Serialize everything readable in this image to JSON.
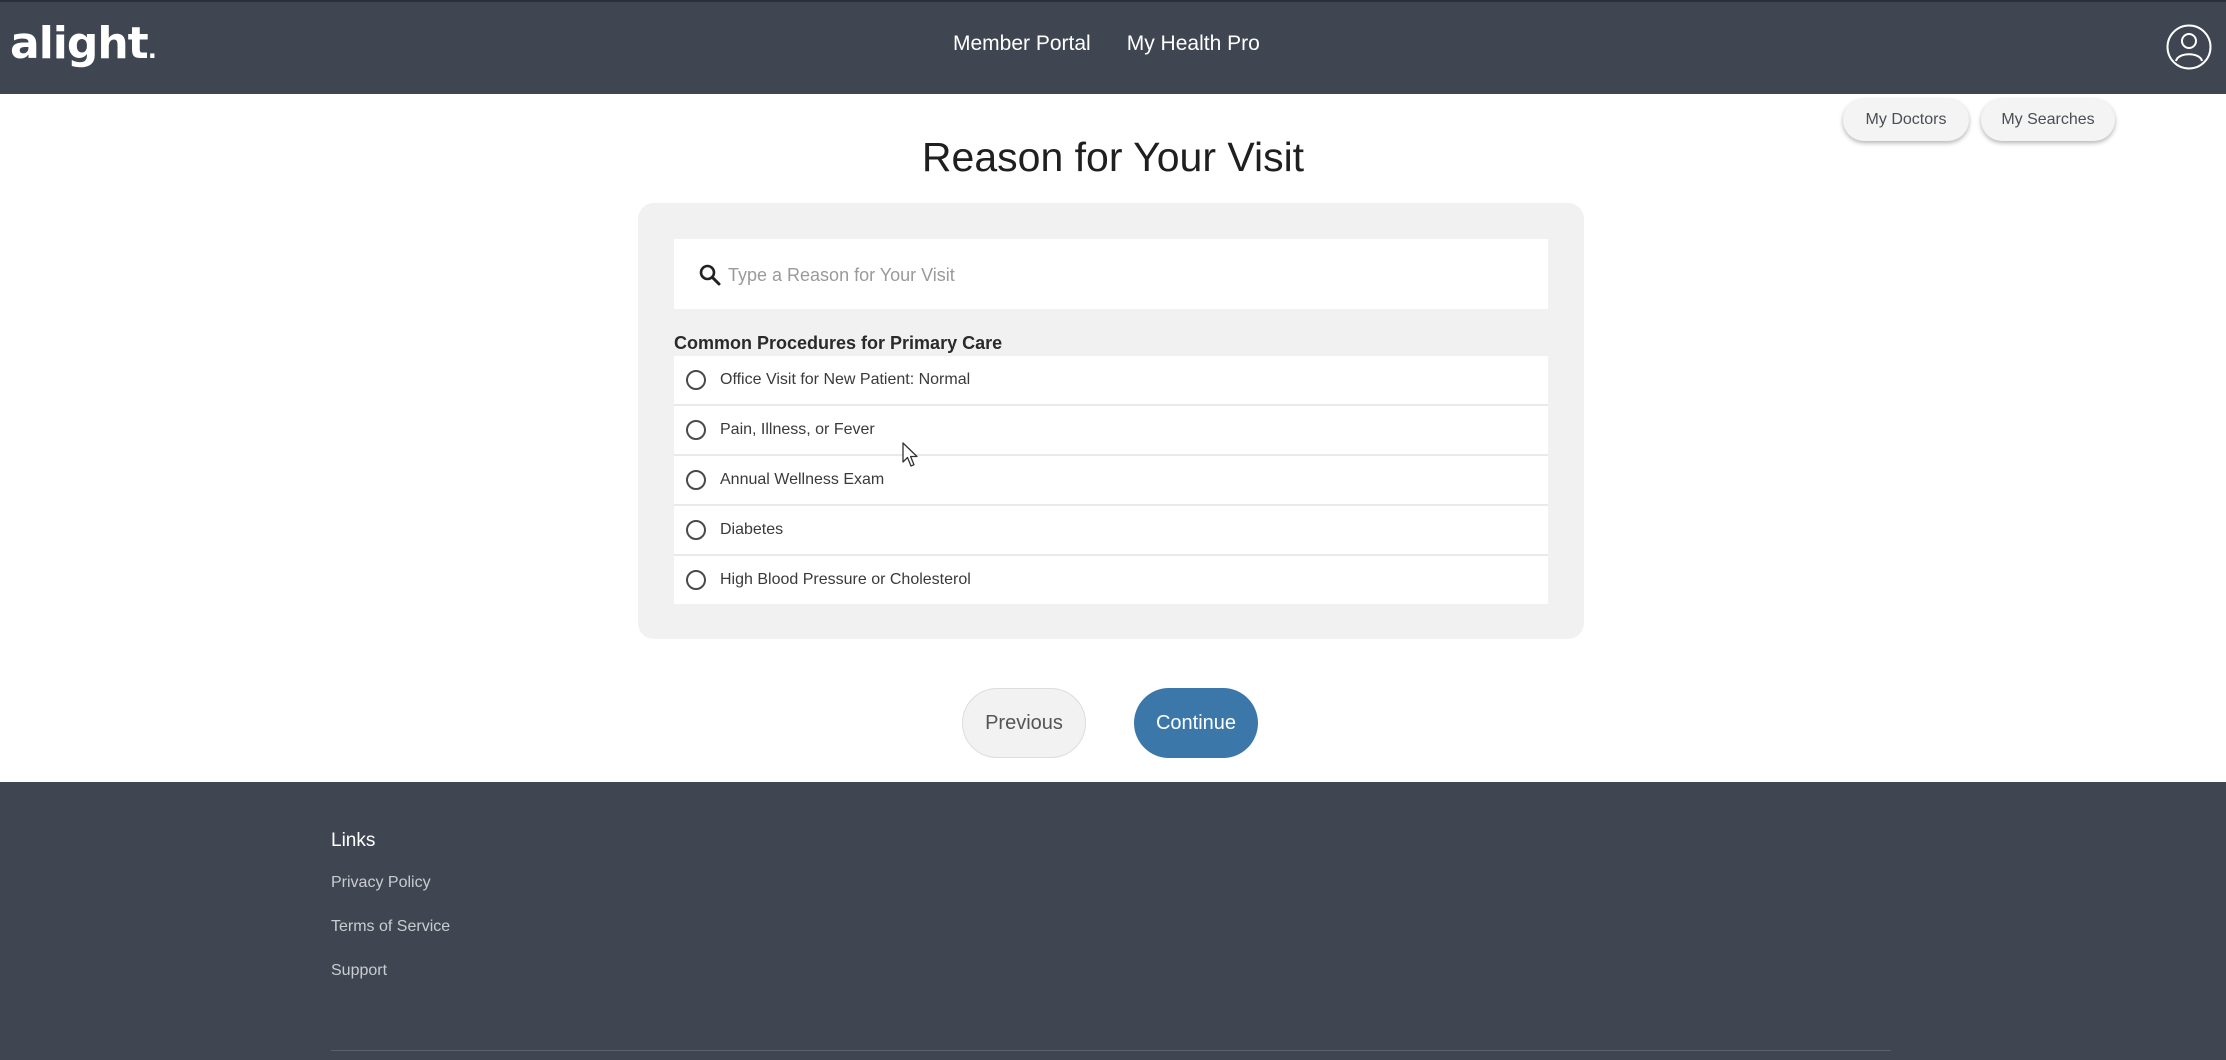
{
  "header": {
    "logo_text": "alight",
    "logo_mark": ".",
    "nav": [
      {
        "label": "Member Portal"
      },
      {
        "label": "My Health Pro"
      }
    ],
    "avatar_icon": "user-circle-icon"
  },
  "quick_links": {
    "my_doctors": "My Doctors",
    "my_searches": "My Searches"
  },
  "page": {
    "title": "Reason for Your Visit"
  },
  "search": {
    "placeholder": "Type a Reason for Your Visit",
    "value": "",
    "icon": "search-icon"
  },
  "procedures": {
    "heading": "Common Procedures for Primary Care",
    "options": [
      {
        "label": "Office Visit for New Patient: Normal",
        "selected": false
      },
      {
        "label": "Pain, Illness, or Fever",
        "selected": false
      },
      {
        "label": "Annual Wellness Exam",
        "selected": false
      },
      {
        "label": "Diabetes",
        "selected": false
      },
      {
        "label": "High Blood Pressure or Cholesterol",
        "selected": false
      }
    ]
  },
  "actions": {
    "previous": "Previous",
    "continue": "Continue"
  },
  "footer": {
    "heading": "Links",
    "links": [
      {
        "label": "Privacy Policy"
      },
      {
        "label": "Terms of Service"
      },
      {
        "label": "Support"
      }
    ]
  },
  "colors": {
    "header_bg": "#3f4651",
    "primary_button": "#3b78a9",
    "card_bg": "#f1f1f1"
  }
}
